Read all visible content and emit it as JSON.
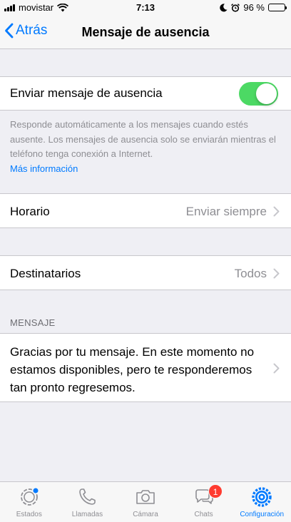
{
  "status_bar": {
    "carrier": "movistar",
    "time": "7:13",
    "battery": "96 %",
    "battery_level": 0.96
  },
  "nav": {
    "back_label": "Atrás",
    "title": "Mensaje de ausencia"
  },
  "away_toggle": {
    "label": "Enviar mensaje de ausencia",
    "enabled": true,
    "color": "#4cd964"
  },
  "footer": {
    "description": "Responde automáticamente a los mensajes cuando estés ausente. Los mensajes de ausencia solo se enviarán mientras el teléfono tenga conexión a Internet.",
    "more_info": "Más información"
  },
  "schedule": {
    "label": "Horario",
    "value": "Enviar siempre"
  },
  "recipients": {
    "label": "Destinatarios",
    "value": "Todos"
  },
  "message_section": {
    "header": "MENSAJE",
    "text": "Gracias por tu mensaje. En este momento no estamos disponibles, pero te responderemos tan pronto regresemos."
  },
  "tabs": [
    {
      "label": "Estados",
      "icon": "status-icon"
    },
    {
      "label": "Llamadas",
      "icon": "phone-icon"
    },
    {
      "label": "Cámara",
      "icon": "camera-icon"
    },
    {
      "label": "Chats",
      "icon": "chats-icon",
      "badge": "1"
    },
    {
      "label": "Configuración",
      "icon": "settings-icon",
      "active": true
    }
  ],
  "colors": {
    "accent": "#007aff",
    "badge": "#ff3b30"
  }
}
